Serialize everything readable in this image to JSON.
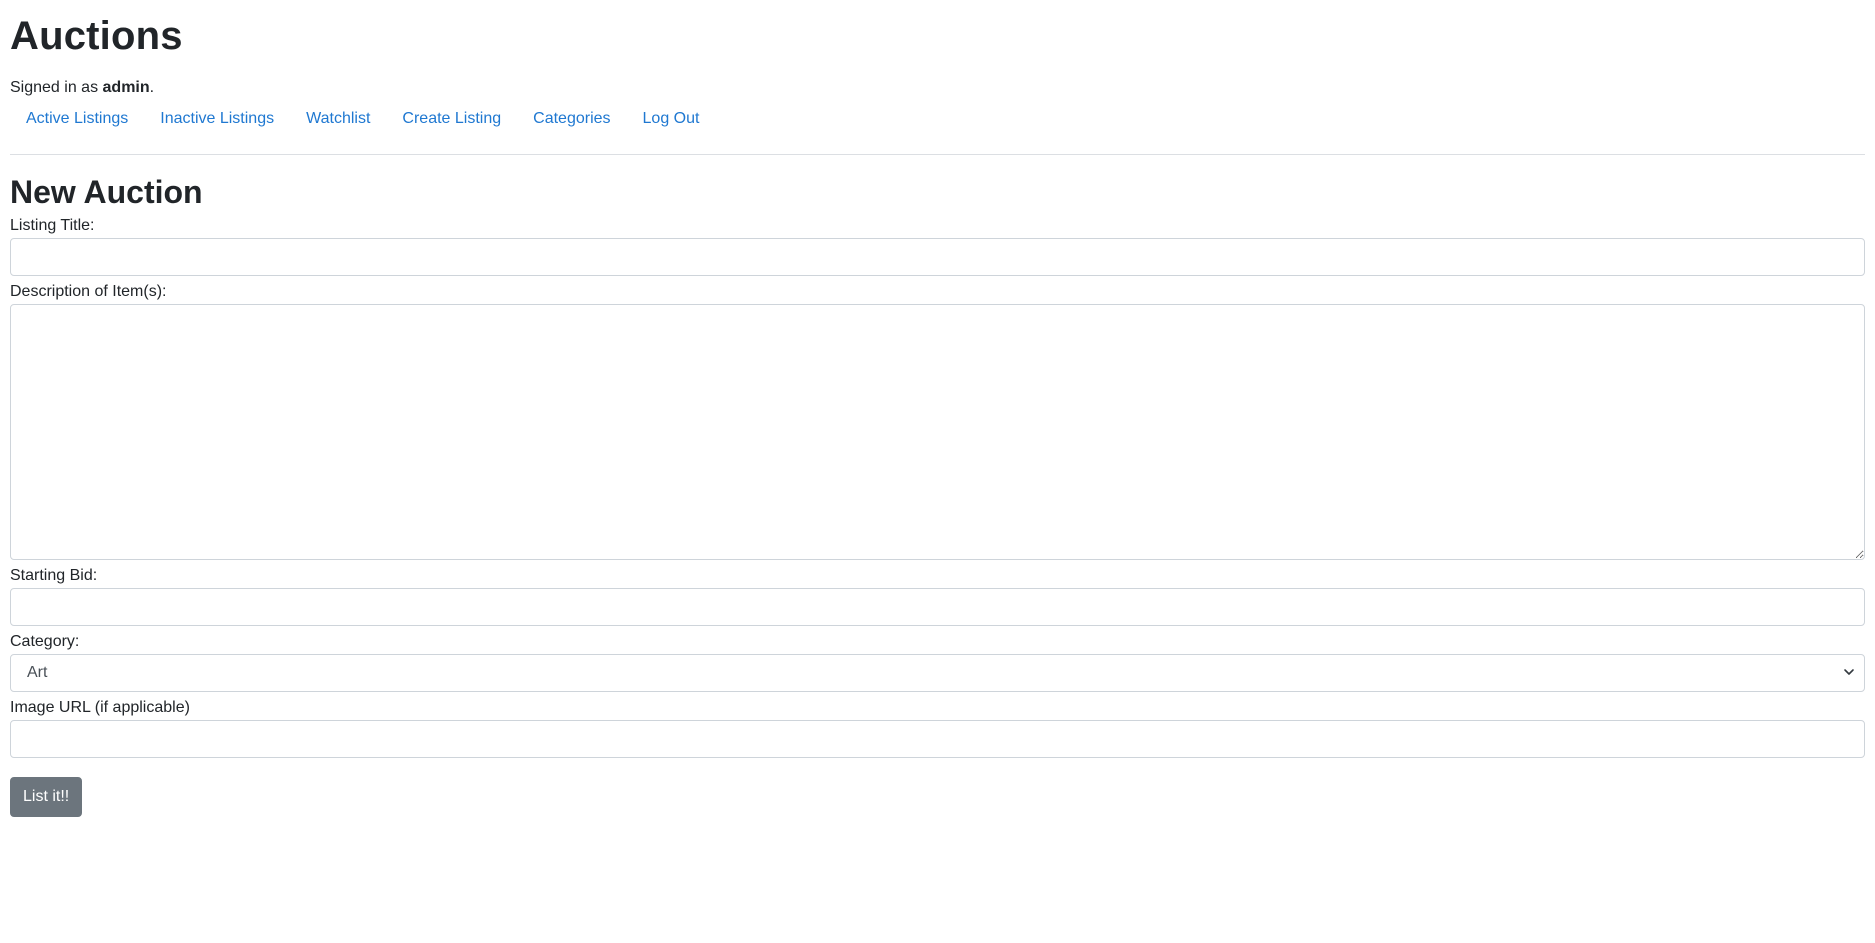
{
  "header": {
    "title": "Auctions",
    "signed_in_prefix": "Signed in as ",
    "username": "admin",
    "signed_in_suffix": "."
  },
  "nav": {
    "items": [
      {
        "label": "Active Listings"
      },
      {
        "label": "Inactive Listings"
      },
      {
        "label": "Watchlist"
      },
      {
        "label": "Create Listing"
      },
      {
        "label": "Categories"
      },
      {
        "label": "Log Out"
      }
    ]
  },
  "form": {
    "title": "New Auction",
    "listing_title_label": "Listing Title:",
    "listing_title_value": "",
    "description_label": "Description of Item(s):",
    "description_value": "",
    "starting_bid_label": "Starting Bid:",
    "starting_bid_value": "",
    "category_label": "Category:",
    "category_selected": "Art",
    "image_url_label": "Image URL (if applicable)",
    "image_url_value": "",
    "submit_label": "List it!!"
  },
  "colors": {
    "link": "#1f78d1",
    "button_bg": "#6c757d",
    "border": "#ced4da"
  }
}
